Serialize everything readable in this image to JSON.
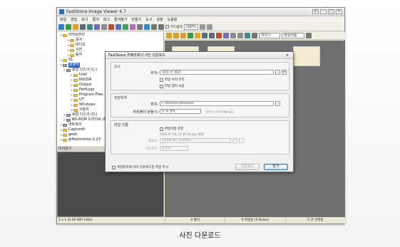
{
  "window": {
    "title": "FastStone Image Viewer 4.7",
    "controls": [
      "⊖",
      "–",
      "□",
      "✕"
    ]
  },
  "menu": [
    "파일",
    "편집",
    "보기",
    "즐겨",
    "태그",
    "즐겨찾기",
    "만들기",
    "도구",
    "설정",
    "도움말"
  ],
  "toolbar": {
    "zoom_value": "100%",
    "fit_checkbox": "부드럽게"
  },
  "folder_tree": [
    {
      "label": "라이브러리",
      "indent": 0,
      "type": "folder"
    },
    {
      "label": "문서",
      "indent": 2,
      "type": "folder"
    },
    {
      "label": "비디오",
      "indent": 2,
      "type": "folder"
    },
    {
      "label": "사진",
      "indent": 2,
      "type": "folder"
    },
    {
      "label": "음악",
      "indent": 2,
      "type": "folder"
    },
    {
      "label": "S1",
      "indent": 0,
      "type": "folder"
    },
    {
      "label": "컴퓨터",
      "indent": 0,
      "type": "drive",
      "selected": true
    },
    {
      "label": "로컬 디스크 (C:)",
      "indent": 1,
      "type": "drive"
    },
    {
      "label": "Intel",
      "indent": 3,
      "type": "folder"
    },
    {
      "label": "NVIDIA",
      "indent": 3,
      "type": "folder"
    },
    {
      "label": "Output",
      "indent": 3,
      "type": "folder"
    },
    {
      "label": "PerfLogs",
      "indent": 3,
      "type": "folder"
    },
    {
      "label": "Program Files",
      "indent": 3,
      "type": "folder"
    },
    {
      "label": "UT",
      "indent": 3,
      "type": "folder"
    },
    {
      "label": "Windows",
      "indent": 3,
      "type": "folder"
    },
    {
      "label": "사용자",
      "indent": 3,
      "type": "folder"
    },
    {
      "label": "로컬 디스크 (D:)",
      "indent": 1,
      "type": "drive"
    },
    {
      "label": "BD-ROM 드라이브 (E:)",
      "indent": 1,
      "type": "drive"
    },
    {
      "label": "네트워크",
      "indent": 0,
      "type": "drive"
    },
    {
      "label": "CaptureIt",
      "indent": 0,
      "type": "folder"
    },
    {
      "label": "geek",
      "indent": 0,
      "type": "folder"
    },
    {
      "label": "giftedmotion-1.23",
      "indent": 0,
      "type": "folder"
    }
  ],
  "preview": {
    "header": "미리보기",
    "status": "1 x 1 (0.00 MP)  24bit"
  },
  "right_pane": {
    "sort_combo": "미리기",
    "name_combo": "파일이름",
    "status": [
      "0 폴더",
      "0 파일들 (0 Bytes)",
      "0 것 선택됨"
    ]
  },
  "dialog": {
    "title": "FastStone 카메라에서 사진 다운로드",
    "close": "✕",
    "source": {
      "label": "소스",
      "location_label": "위치:",
      "location_value": "(없음 or 없음)",
      "include_sub": "파일 위치 유지",
      "date_based": "파일 필터 사용"
    },
    "dest": {
      "label": "저장위치",
      "folder_label": "위치:",
      "folder_value": "C:\\Users\\s1\\Pictures",
      "subfolder_label": "하위폴더 만들기:",
      "subfolder_value": "년 & 날짜",
      "subfolder_sample": "YYYY \\ YYYY-MM-DD"
    },
    "rename": {
      "label": "파일 이름",
      "rename_check": "파일이름 변경",
      "rename_sample": "2010-07-04_14-46-56.jpg (예제)",
      "pattern_label": "템플릿:",
      "pattern_value": "$Y-$M-$D_$H$N$S",
      "case_label": "대소문자:",
      "case_value": "소문자"
    },
    "overwrite": "저장위치에 이미 다운로드된 파일 무시",
    "download_btn": "다운로드",
    "close_btn": "닫기"
  },
  "caption": "사진 다운로드"
}
